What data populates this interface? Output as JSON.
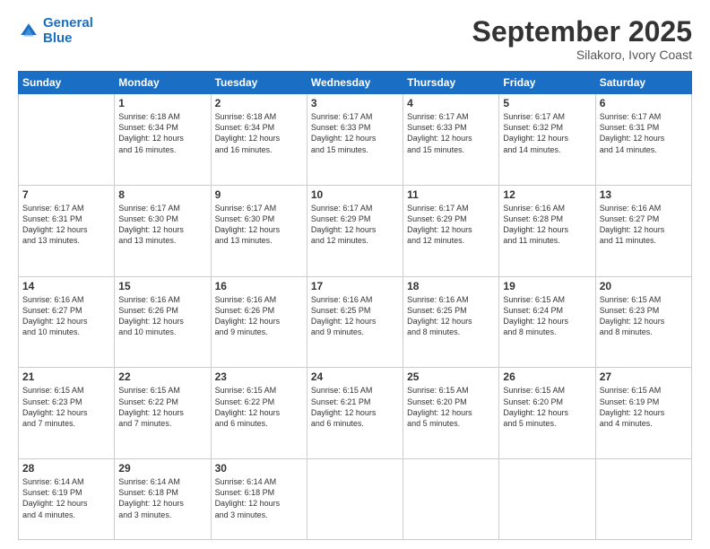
{
  "header": {
    "logo_line1": "General",
    "logo_line2": "Blue",
    "month": "September 2025",
    "location": "Silakoro, Ivory Coast"
  },
  "weekdays": [
    "Sunday",
    "Monday",
    "Tuesday",
    "Wednesday",
    "Thursday",
    "Friday",
    "Saturday"
  ],
  "weeks": [
    [
      {
        "num": "",
        "info": ""
      },
      {
        "num": "1",
        "info": "Sunrise: 6:18 AM\nSunset: 6:34 PM\nDaylight: 12 hours\nand 16 minutes."
      },
      {
        "num": "2",
        "info": "Sunrise: 6:18 AM\nSunset: 6:34 PM\nDaylight: 12 hours\nand 16 minutes."
      },
      {
        "num": "3",
        "info": "Sunrise: 6:17 AM\nSunset: 6:33 PM\nDaylight: 12 hours\nand 15 minutes."
      },
      {
        "num": "4",
        "info": "Sunrise: 6:17 AM\nSunset: 6:33 PM\nDaylight: 12 hours\nand 15 minutes."
      },
      {
        "num": "5",
        "info": "Sunrise: 6:17 AM\nSunset: 6:32 PM\nDaylight: 12 hours\nand 14 minutes."
      },
      {
        "num": "6",
        "info": "Sunrise: 6:17 AM\nSunset: 6:31 PM\nDaylight: 12 hours\nand 14 minutes."
      }
    ],
    [
      {
        "num": "7",
        "info": "Sunrise: 6:17 AM\nSunset: 6:31 PM\nDaylight: 12 hours\nand 13 minutes."
      },
      {
        "num": "8",
        "info": "Sunrise: 6:17 AM\nSunset: 6:30 PM\nDaylight: 12 hours\nand 13 minutes."
      },
      {
        "num": "9",
        "info": "Sunrise: 6:17 AM\nSunset: 6:30 PM\nDaylight: 12 hours\nand 13 minutes."
      },
      {
        "num": "10",
        "info": "Sunrise: 6:17 AM\nSunset: 6:29 PM\nDaylight: 12 hours\nand 12 minutes."
      },
      {
        "num": "11",
        "info": "Sunrise: 6:17 AM\nSunset: 6:29 PM\nDaylight: 12 hours\nand 12 minutes."
      },
      {
        "num": "12",
        "info": "Sunrise: 6:16 AM\nSunset: 6:28 PM\nDaylight: 12 hours\nand 11 minutes."
      },
      {
        "num": "13",
        "info": "Sunrise: 6:16 AM\nSunset: 6:27 PM\nDaylight: 12 hours\nand 11 minutes."
      }
    ],
    [
      {
        "num": "14",
        "info": "Sunrise: 6:16 AM\nSunset: 6:27 PM\nDaylight: 12 hours\nand 10 minutes."
      },
      {
        "num": "15",
        "info": "Sunrise: 6:16 AM\nSunset: 6:26 PM\nDaylight: 12 hours\nand 10 minutes."
      },
      {
        "num": "16",
        "info": "Sunrise: 6:16 AM\nSunset: 6:26 PM\nDaylight: 12 hours\nand 9 minutes."
      },
      {
        "num": "17",
        "info": "Sunrise: 6:16 AM\nSunset: 6:25 PM\nDaylight: 12 hours\nand 9 minutes."
      },
      {
        "num": "18",
        "info": "Sunrise: 6:16 AM\nSunset: 6:25 PM\nDaylight: 12 hours\nand 8 minutes."
      },
      {
        "num": "19",
        "info": "Sunrise: 6:15 AM\nSunset: 6:24 PM\nDaylight: 12 hours\nand 8 minutes."
      },
      {
        "num": "20",
        "info": "Sunrise: 6:15 AM\nSunset: 6:23 PM\nDaylight: 12 hours\nand 8 minutes."
      }
    ],
    [
      {
        "num": "21",
        "info": "Sunrise: 6:15 AM\nSunset: 6:23 PM\nDaylight: 12 hours\nand 7 minutes."
      },
      {
        "num": "22",
        "info": "Sunrise: 6:15 AM\nSunset: 6:22 PM\nDaylight: 12 hours\nand 7 minutes."
      },
      {
        "num": "23",
        "info": "Sunrise: 6:15 AM\nSunset: 6:22 PM\nDaylight: 12 hours\nand 6 minutes."
      },
      {
        "num": "24",
        "info": "Sunrise: 6:15 AM\nSunset: 6:21 PM\nDaylight: 12 hours\nand 6 minutes."
      },
      {
        "num": "25",
        "info": "Sunrise: 6:15 AM\nSunset: 6:20 PM\nDaylight: 12 hours\nand 5 minutes."
      },
      {
        "num": "26",
        "info": "Sunrise: 6:15 AM\nSunset: 6:20 PM\nDaylight: 12 hours\nand 5 minutes."
      },
      {
        "num": "27",
        "info": "Sunrise: 6:15 AM\nSunset: 6:19 PM\nDaylight: 12 hours\nand 4 minutes."
      }
    ],
    [
      {
        "num": "28",
        "info": "Sunrise: 6:14 AM\nSunset: 6:19 PM\nDaylight: 12 hours\nand 4 minutes."
      },
      {
        "num": "29",
        "info": "Sunrise: 6:14 AM\nSunset: 6:18 PM\nDaylight: 12 hours\nand 3 minutes."
      },
      {
        "num": "30",
        "info": "Sunrise: 6:14 AM\nSunset: 6:18 PM\nDaylight: 12 hours\nand 3 minutes."
      },
      {
        "num": "",
        "info": ""
      },
      {
        "num": "",
        "info": ""
      },
      {
        "num": "",
        "info": ""
      },
      {
        "num": "",
        "info": ""
      }
    ]
  ]
}
